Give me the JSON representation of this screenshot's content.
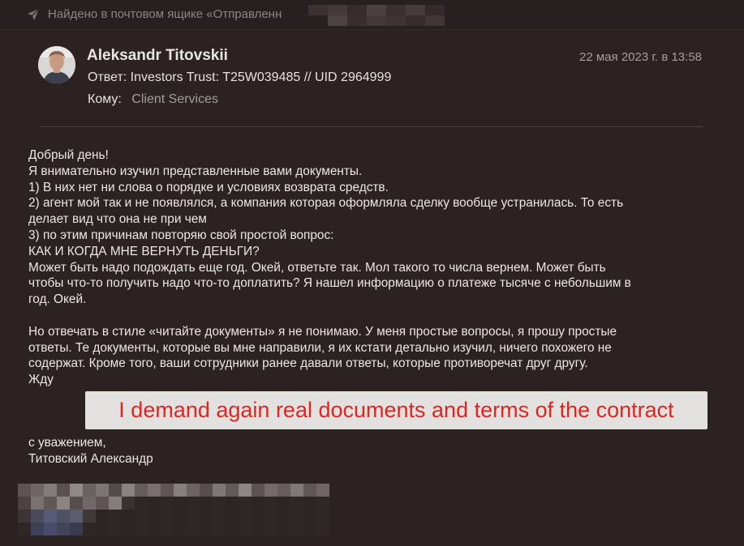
{
  "header": {
    "found_text": "Найдено в почтовом ящике «Отправленн"
  },
  "message": {
    "sender": "Aleksandr Titovskii",
    "date": "22 мая 2023 г. в 13:58",
    "subject": "Ответ: Investors Trust: T25W039485 // UID 2964999",
    "to_label": "Кому:",
    "to_value": "Client Services",
    "body_lines": [
      "Добрый день!",
      "Я внимательно изучил представленные вами документы.",
      "1) В них нет ни слова о порядке и условиях возврата средств.",
      "2) агент мой так и не появлялся, а компания которая оформляла сделку вообще устранилась. То есть",
      "делает вид что она не при чем",
      "3) по этим причинам повторяю свой простой вопрос:",
      "КАК И КОГДА МНЕ ВЕРНУТЬ ДЕНЬГИ?",
      "Может быть надо подождать еще год. Окей, ответьте так. Мол такого то числа вернем. Может быть",
      "чтобы что-то получить надо что-то доплатить? Я нашел информацию о платеже тысяче с небольшим в",
      "год. Окей.",
      "",
      "Но отвечать в стиле «читайте документы» я не понимаю. У меня простые вопросы, я прошу простые",
      "ответы. Те документы, которые вы мне направили, я их кстати детально изучил, ничего похожего не",
      "содержат. Кроме того, ваши сотрудники ранее давали ответы, которые противоречат друг другу.",
      "Жду"
    ],
    "closing": "с уважением,",
    "signature": "Титовский Александр"
  },
  "overlay": {
    "banner_text": "I demand again real documents and terms of the contract",
    "banner_color": "#e0241f"
  },
  "icons": {
    "send": "paper-plane-icon",
    "avatar": "avatar"
  }
}
